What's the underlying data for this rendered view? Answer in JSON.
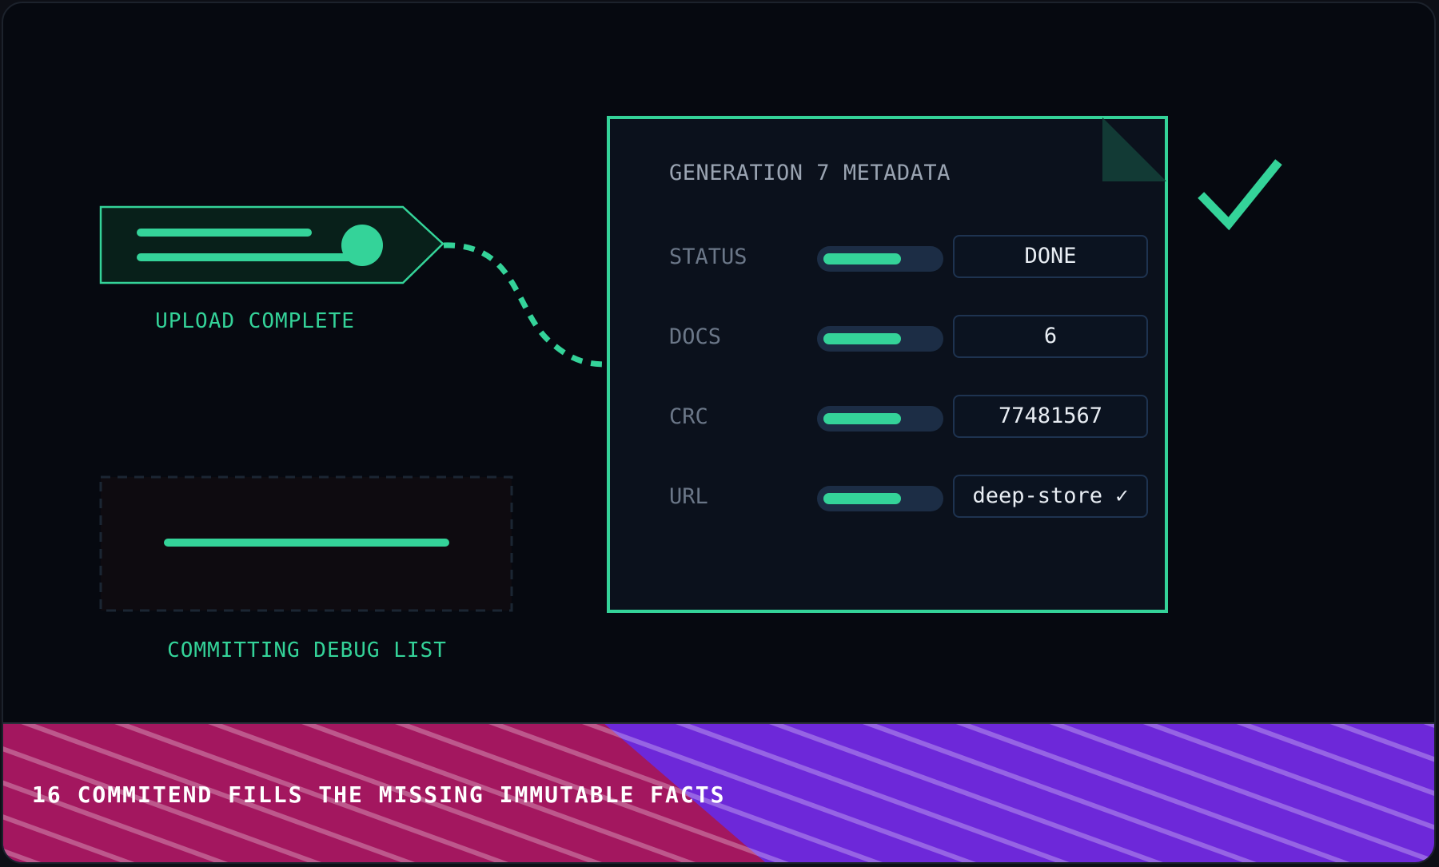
{
  "upload": {
    "label": "UPLOAD COMPLETE"
  },
  "debug": {
    "label": "COMMITTING DEBUG LIST"
  },
  "metadata": {
    "title": "GENERATION 7 METADATA",
    "rows": [
      {
        "label": "STATUS",
        "value": "DONE",
        "fill": 0.68
      },
      {
        "label": "DOCS",
        "value": "6",
        "fill": 0.68
      },
      {
        "label": "CRC",
        "value": "77481567",
        "fill": 0.68
      },
      {
        "label": "URL",
        "value": "deep-store ✓",
        "fill": 0.68
      }
    ]
  },
  "banner": {
    "text": "16 COMMITEND FILLS THE MISSING IMMUTABLE FACTS"
  },
  "icons": {
    "status": "checkmark-icon"
  },
  "colors": {
    "accent": "#34d399",
    "background": "#060910",
    "panel": "#0b111c",
    "banner_left": "#a3175f",
    "banner_right": "#6d28d9"
  }
}
